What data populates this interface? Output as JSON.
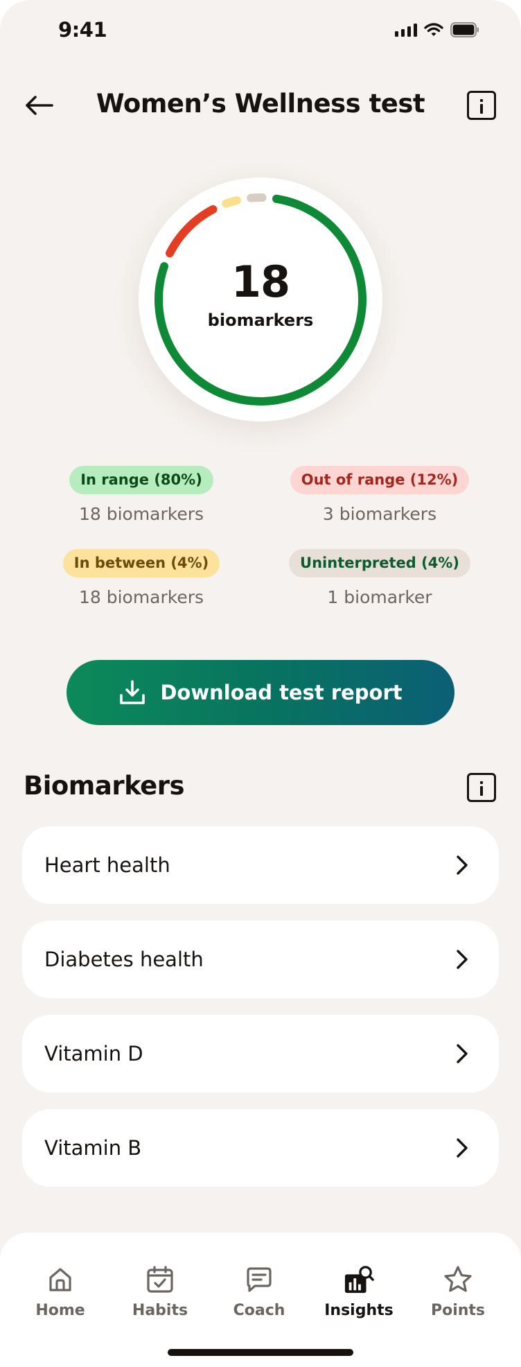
{
  "status_bar": {
    "time": "9:41"
  },
  "header": {
    "title": "Women’s Wellness test"
  },
  "summary": {
    "count": "18",
    "label": "biomarkers",
    "segments": [
      {
        "name": "In range",
        "percent": 80,
        "color": "#0e8a36"
      },
      {
        "name": "Out of range",
        "percent": 12,
        "color": "#e33e24"
      },
      {
        "name": "In between",
        "percent": 4,
        "color": "#fbe08c"
      },
      {
        "name": "Uninterpreted",
        "percent": 4,
        "color": "#d7cdc3"
      }
    ]
  },
  "legend": [
    {
      "pill": "In range (80%)",
      "count": "18 biomarkers",
      "bg": "#b7edbe",
      "fg": "#0c4a1c"
    },
    {
      "pill": "Out of range (12%)",
      "count": "3 biomarkers",
      "bg": "#fdd5d2",
      "fg": "#a3271c"
    },
    {
      "pill": "In between (4%)",
      "count": "18 biomarkers",
      "bg": "#fde29b",
      "fg": "#6e4a0a"
    },
    {
      "pill": "Uninterpreted (4%)",
      "count": "1 biomarker",
      "bg": "#e7dfd8",
      "fg": "#0d5a2c"
    }
  ],
  "download": {
    "label": "Download test report"
  },
  "biomarkers": {
    "title": "Biomarkers",
    "items": [
      {
        "label": "Heart health"
      },
      {
        "label": "Diabetes health"
      },
      {
        "label": "Vitamin D"
      },
      {
        "label": "Vitamin B"
      }
    ]
  },
  "tabs": [
    {
      "label": "Home",
      "icon": "home-icon"
    },
    {
      "label": "Habits",
      "icon": "calendar-check-icon"
    },
    {
      "label": "Coach",
      "icon": "chat-icon"
    },
    {
      "label": "Insights",
      "icon": "insights-chart-icon",
      "active": true
    },
    {
      "label": "Points",
      "icon": "star-icon"
    }
  ]
}
